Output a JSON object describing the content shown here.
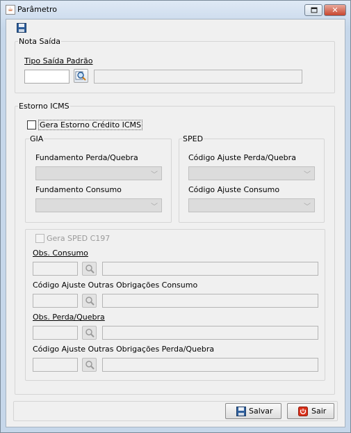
{
  "window": {
    "title": "Parâmetro",
    "app_icon": "java-cup-icon",
    "controls": {
      "restore": "restore-icon",
      "close": "close-icon",
      "close_glyph": "✕"
    }
  },
  "toolbar": {
    "save_icon": "floppy-disk-icon"
  },
  "nota_saida": {
    "legend": "Nota Saída",
    "tipo_saida_label": "Tipo Saída Padrão",
    "tipo_saida_code": "",
    "tipo_saida_desc": ""
  },
  "estorno": {
    "legend": "Estorno ICMS",
    "gera_estorno_label": "Gera Estorno Crédito ICMS",
    "gera_estorno_checked": false,
    "gia": {
      "legend": "GIA",
      "fundamento_perda_label": "Fundamento Perda/Quebra",
      "fundamento_perda_value": "",
      "fundamento_consumo_label": "Fundamento Consumo",
      "fundamento_consumo_value": ""
    },
    "sped": {
      "legend": "SPED",
      "ajuste_perda_label": "Código Ajuste Perda/Quebra",
      "ajuste_perda_value": "",
      "ajuste_consumo_label": "Código Ajuste Consumo",
      "ajuste_consumo_value": ""
    },
    "c197": {
      "gera_label": "Gera SPED C197",
      "gera_checked": false,
      "obs_consumo_label": "Obs. Consumo",
      "cod_outras_consumo_label": "Código Ajuste Outras Obrigações Consumo",
      "obs_perda_label": "Obs. Perda/Quebra",
      "cod_outras_perda_label": "Código Ajuste Outras Obrigações Perda/Quebra"
    }
  },
  "footer": {
    "save_label": "Salvar",
    "exit_label": "Sair",
    "save_icon": "floppy-disk-icon",
    "exit_icon": "power-icon",
    "exit_color": "#d9301a"
  }
}
